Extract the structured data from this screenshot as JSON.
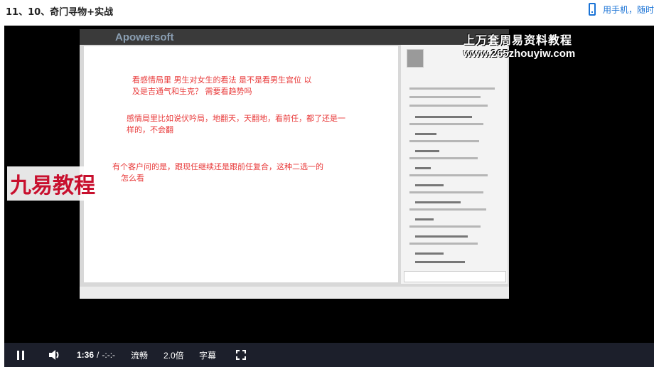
{
  "header": {
    "title": "11、10、奇门寻物+实战",
    "mobile_link": "用手机，随时"
  },
  "video": {
    "app_watermark": "Apowersoft",
    "site_brand": "上万套周易资料教程",
    "site_url": "www.265zhouyiw.com",
    "logo_text": "九易教程",
    "handwriting": {
      "line1": "看感情局里 男生对女生的看法 是不是看男生宫位 以",
      "line2": "及是吉通气和生克？ 需要看趋势吗",
      "line3": "感情局里比如说伏吟局，地翻天，天翻地，看前任，都了还是一",
      "line4": "样的，不会翻",
      "line5": "有个客户问的是，跟现任继续还是跟前任复合，这种二选一的",
      "line6": "怎么看"
    }
  },
  "controls": {
    "current_time": "1:36",
    "separator": "/",
    "duration": "-:-:-",
    "quality": "流畅",
    "speed": "2.0倍",
    "subtitles": "字幕"
  }
}
